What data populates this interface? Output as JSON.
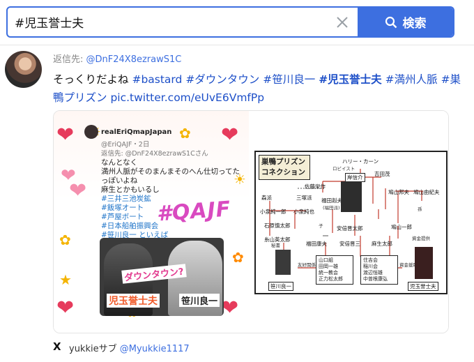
{
  "search": {
    "query": "#児玉誉士夫",
    "button_label": "検索",
    "clear_icon": "close-icon",
    "search_icon": "search-icon"
  },
  "colors": {
    "accent": "#3d6fe0",
    "hashtag": "#1d4fc8"
  },
  "tweet": {
    "reply_prefix": "返信先:",
    "reply_handle": "@DnF24X8ezrawS1C",
    "text_lead": "そっくりだよね",
    "tags": [
      "#bastard",
      "#ダウンタウン",
      "#笹川良一",
      "#児玉誉士夫",
      "#満州人脈",
      "#巣鴨プリズン"
    ],
    "link": "pic.twitter.com/eUvE6VmfPp"
  },
  "media_left": {
    "inner_name": "realEriQmapJapan",
    "inner_meta": "@EriQAJF・2日",
    "inner_reply": "返信先: @DnF24X8ezrawS1Cさん",
    "lines": [
      "なんとなく",
      "満州人脈がそのまんまそのへん仕切ってた",
      "っぽいよね",
      "麻生とかもいるし"
    ],
    "tags": [
      "#三井三池炭鉱",
      "#飯塚オート",
      "#芦屋ボート",
      "#日本船舶振興会",
      "#笹川良一 といえば"
    ],
    "stamp": "#QAJF",
    "caption_downtown": "ダウンタウン?",
    "caption_kodama": "児玉誉士夫",
    "caption_sasakawa": "笹川良一"
  },
  "media_right": {
    "title": "巣鴨プリズン コネクション",
    "names": {
      "harry": "ハリー・カーン",
      "lobbyist": "ロビイスト",
      "yoshida": "吉田茂",
      "kishi": "岸信介",
      "sato": "佐藤栄作",
      "hatoyama_k": "鳩山邦夫",
      "hatoyama_y": "鳩山由紀夫",
      "fukuda_t": "福田赳夫",
      "fukuda_sub": "(福田派)",
      "mori": "森派",
      "sanzuka": "三塚派",
      "koizumi_j": "小泉純一郎",
      "koizumi_s": "小泉純也",
      "ishihara": "石原慎太郎",
      "itoyama": "糸山英太郎",
      "abe_s": "安倍晋太郎",
      "abe": "安倍晋三",
      "aso": "麻生太郎",
      "hatoyama_i": "鳩山一郎",
      "fukuda_y": "福田康夫",
      "sasakawa": "笹川良一",
      "kodama": "児玉誉士夫",
      "yamaguchi": "山口組",
      "taoka": "田岡一雄",
      "tokyu": "統一教会",
      "matsu": "正力松太郎",
      "sumiyoshi": "住吉会",
      "inagawa": "稲川会",
      "watanabe": "渡辺恒雄",
      "nakasone": "中曽根康弘",
      "role_oji": "叔父",
      "role_son": "孫",
      "role_child": "子",
      "role_brother": "弟",
      "role_aide": "秘書",
      "role_fund": "資金提供",
      "role_friend": "友好関係",
      "role_money": "資金援助"
    }
  },
  "footer": {
    "x_icon": "X",
    "retweeter": "yukkieサブ",
    "retweeter_handle": "@Myukkie1117"
  }
}
